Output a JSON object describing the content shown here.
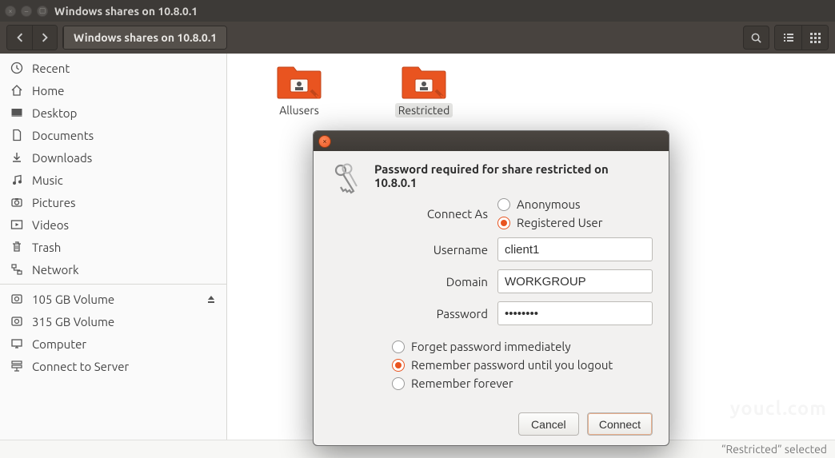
{
  "titlebar": {
    "title": "Windows shares on 10.8.0.1"
  },
  "toolbar": {
    "path_segment": "Windows shares on 10.8.0.1"
  },
  "sidebar": {
    "items": [
      {
        "label": "Recent",
        "icon": "clock-icon"
      },
      {
        "label": "Home",
        "icon": "home-icon"
      },
      {
        "label": "Desktop",
        "icon": "desktop-icon"
      },
      {
        "label": "Documents",
        "icon": "documents-icon"
      },
      {
        "label": "Downloads",
        "icon": "downloads-icon"
      },
      {
        "label": "Music",
        "icon": "music-icon"
      },
      {
        "label": "Pictures",
        "icon": "pictures-icon"
      },
      {
        "label": "Videos",
        "icon": "videos-icon"
      },
      {
        "label": "Trash",
        "icon": "trash-icon"
      },
      {
        "label": "Network",
        "icon": "network-icon"
      }
    ],
    "items2": [
      {
        "label": "105 GB Volume",
        "icon": "disk-icon",
        "eject": true
      },
      {
        "label": "315 GB Volume",
        "icon": "disk-icon"
      },
      {
        "label": "Computer",
        "icon": "computer-icon"
      },
      {
        "label": "Connect to Server",
        "icon": "connect-server-icon"
      }
    ]
  },
  "files": [
    {
      "label": "Allusers",
      "selected": false
    },
    {
      "label": "Restricted",
      "selected": true
    }
  ],
  "statusbar": {
    "text": "“Restricted” selected"
  },
  "watermark": "youcl.com",
  "dialog": {
    "title": "Password required for share restricted on 10.8.0.1",
    "connect_as_label": "Connect As",
    "radio_anonymous": "Anonymous",
    "radio_registered": "Registered User",
    "username_label": "Username",
    "username_value": "client1",
    "domain_label": "Domain",
    "domain_value": "WORKGROUP",
    "password_label": "Password",
    "password_value": "••••••••",
    "remember_forget": "Forget password immediately",
    "remember_logout": "Remember password until you logout",
    "remember_forever": "Remember forever",
    "cancel_label": "Cancel",
    "connect_label": "Connect"
  }
}
